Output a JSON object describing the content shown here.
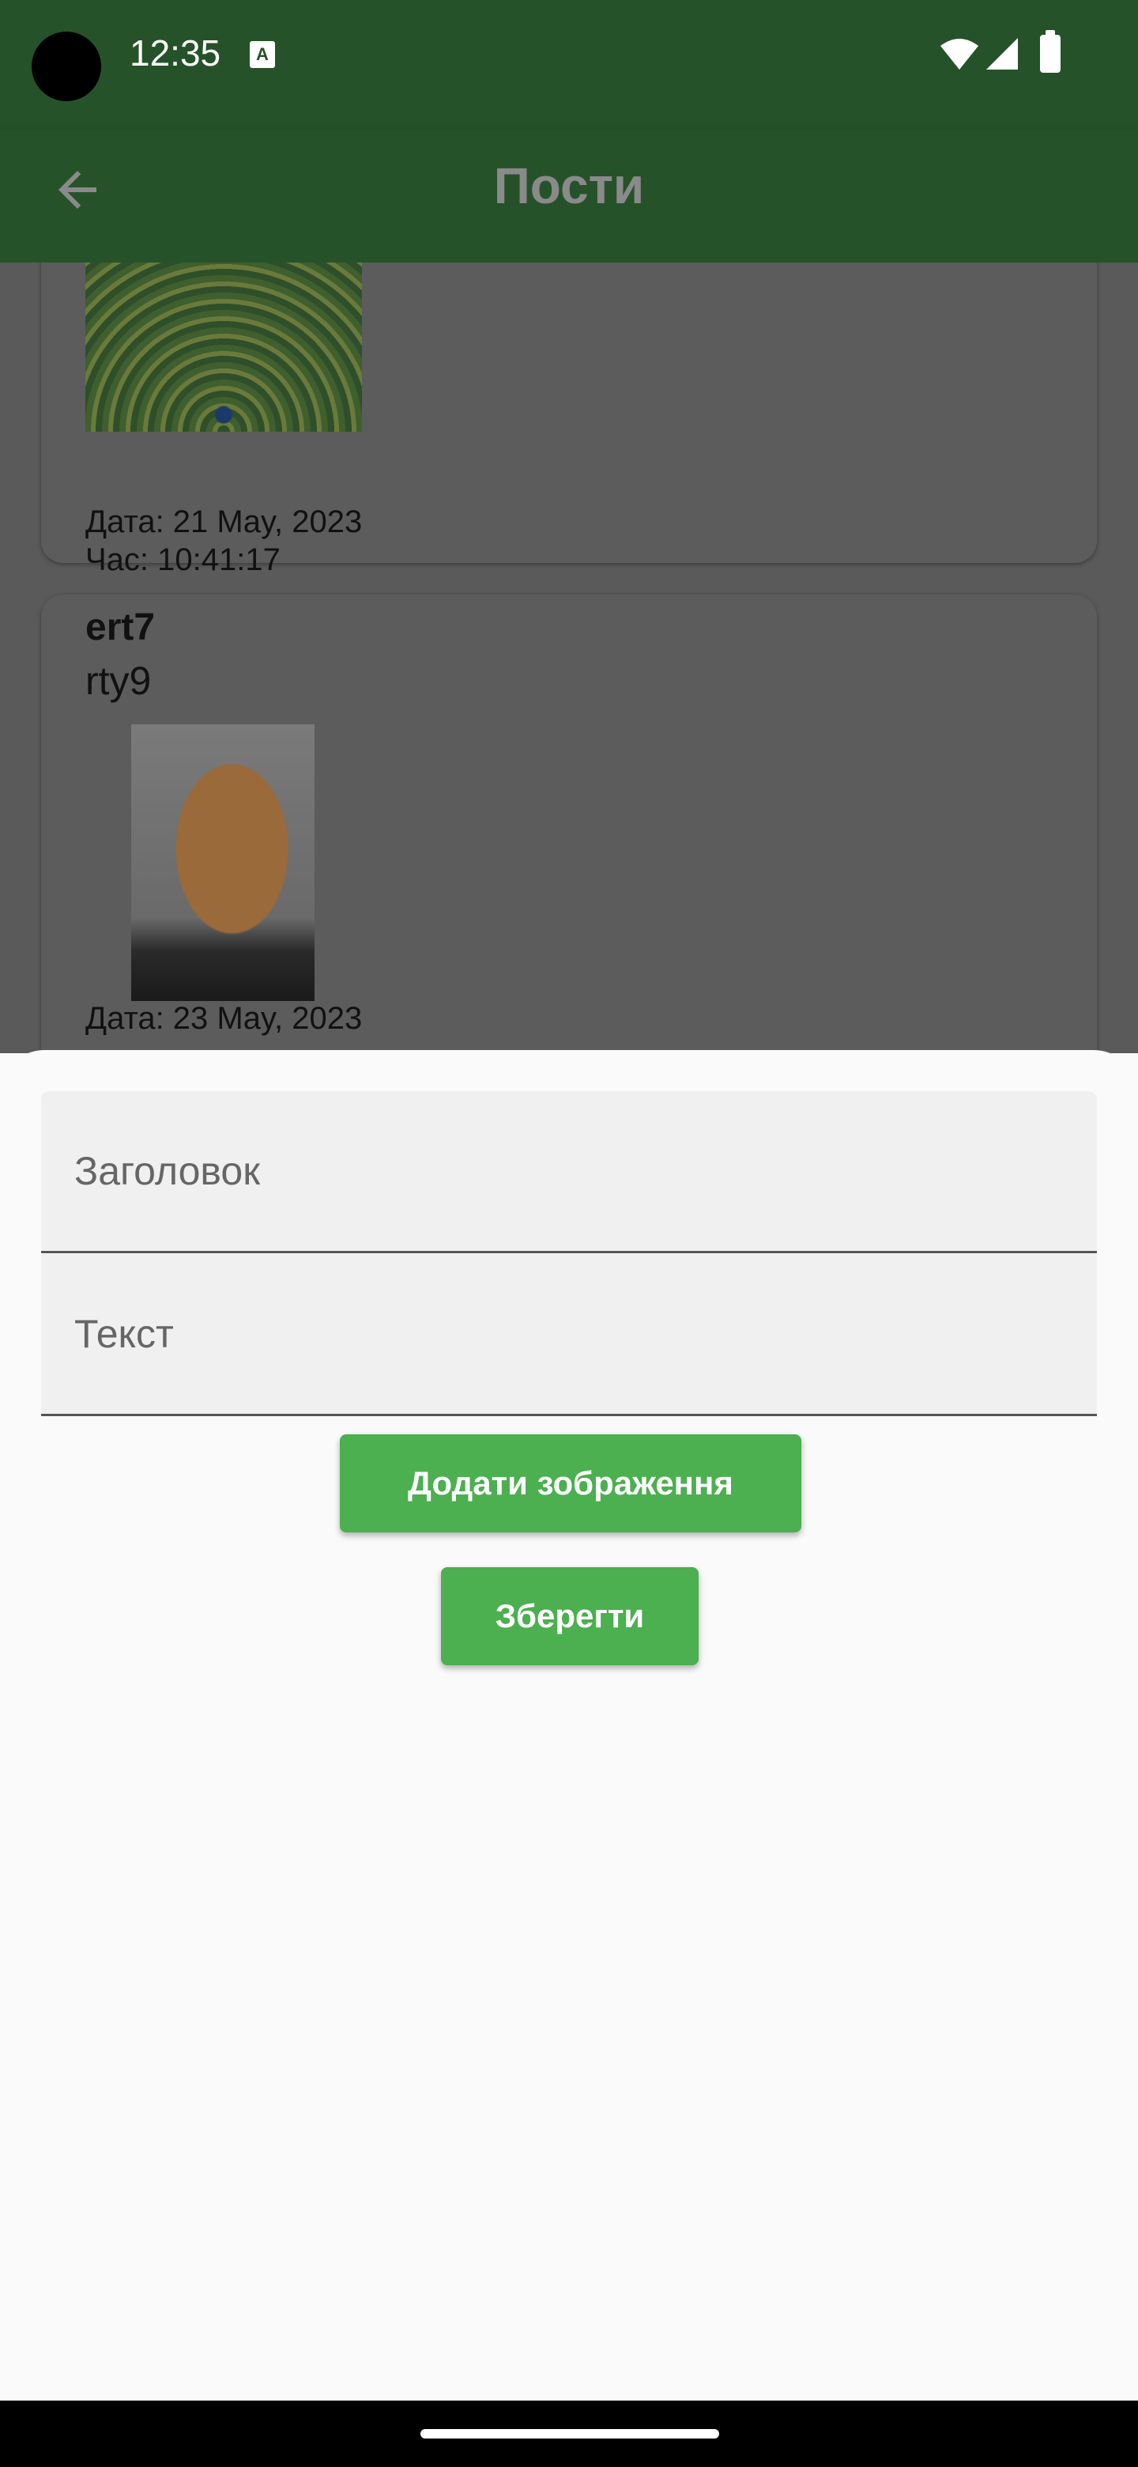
{
  "status": {
    "time": "12:35",
    "a_badge": "A"
  },
  "appbar": {
    "title": "Пости"
  },
  "posts": [
    {
      "date": "Дата: 21 May, 2023",
      "time": "Час: 10:41:17"
    },
    {
      "title": "ert7",
      "body": "rty9",
      "date": "Дата: 23 May, 2023"
    }
  ],
  "sheet": {
    "title_placeholder": "Заголовок",
    "text_placeholder": "Текст",
    "add_image_label": "Додати зображення",
    "save_label": "Зберегти"
  },
  "colors": {
    "primary_dark": "#26522a",
    "button_green": "#4caf50",
    "sheet_bg": "#fafafa",
    "scrim": "#5a5a5a"
  }
}
